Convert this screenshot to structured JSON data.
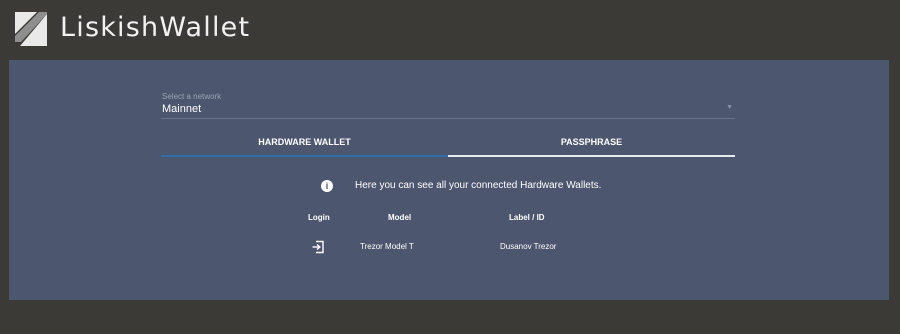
{
  "app": {
    "title": "LiskishWallet"
  },
  "network": {
    "label": "Select a network",
    "value": "Mainnet"
  },
  "tabs": [
    {
      "label": "HARDWARE WALLET",
      "active": true
    },
    {
      "label": "PASSPHRASE",
      "active": false
    }
  ],
  "info": {
    "icon": "info-icon",
    "text": "Here you can see all your connected Hardware Wallets."
  },
  "table": {
    "headers": [
      "Login",
      "Model",
      "Label / ID"
    ],
    "rows": [
      {
        "login_icon": "login-icon",
        "model": "Trezor Model T",
        "label": "Dusanov Trezor"
      }
    ]
  },
  "colors": {
    "background": "#3b3a36",
    "panel": "#4c566e",
    "active_tab_underline": "#2f6ea8",
    "text": "#ffffff"
  }
}
